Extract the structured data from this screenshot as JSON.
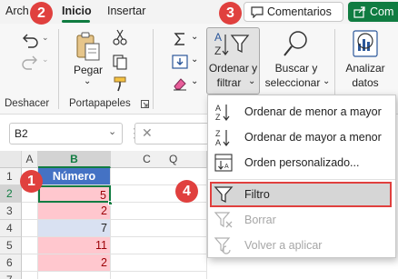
{
  "tabs": {
    "archivo": "Arch",
    "inicio": "Inicio",
    "insertar": "Insertar"
  },
  "top_buttons": {
    "comentarios": "Comentarios",
    "compartir": "Com"
  },
  "ribbon": {
    "undo_group_label": "Deshacer",
    "clipboard": {
      "paste_label": "Pegar",
      "group_label": "Portapapeles"
    },
    "sort_filter": {
      "line1": "Ordenar y",
      "line2": "filtrar"
    },
    "find_select": {
      "line1": "Buscar y",
      "line2": "seleccionar"
    },
    "analyze": {
      "line1": "Analizar",
      "line2": "datos"
    }
  },
  "formula_bar": {
    "name_box": "B2"
  },
  "grid": {
    "columns": [
      "A",
      "B",
      "C",
      "Q"
    ],
    "rows": [
      "1",
      "2",
      "3",
      "4",
      "5",
      "6",
      "7"
    ],
    "header_cell": "Número",
    "values": [
      "5",
      "2",
      "7",
      "11",
      "2"
    ]
  },
  "menu": {
    "items": [
      {
        "label": "Ordenar de menor a mayor",
        "enabled": true
      },
      {
        "label": "Ordenar de mayor a menor",
        "enabled": true
      },
      {
        "label": "Orden personalizado...",
        "enabled": true
      },
      {
        "label": "Filtro",
        "enabled": true,
        "highlighted": true
      },
      {
        "label": "Borrar",
        "enabled": false
      },
      {
        "label": "Volver a aplicar",
        "enabled": false
      }
    ]
  },
  "annotations": [
    "1",
    "2",
    "3",
    "4"
  ],
  "colors": {
    "accent_green": "#107c41",
    "header_blue": "#4472c4",
    "row_pink": "#ffc7ce",
    "row_blue": "#d9e1f2",
    "annotation_red": "#e0403e",
    "highlight_border": "#e0403e"
  }
}
